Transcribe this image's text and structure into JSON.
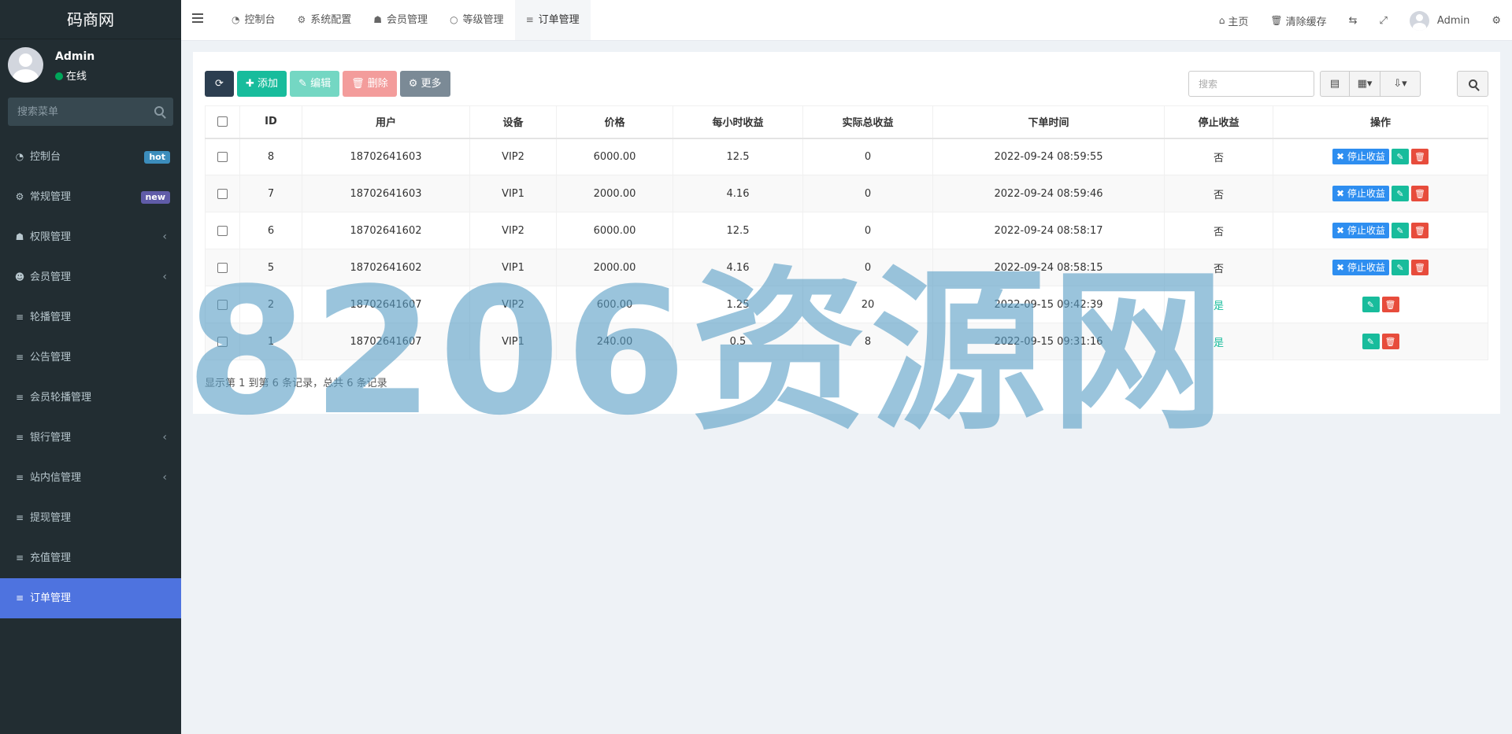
{
  "brand": "码商网",
  "user": {
    "name": "Admin",
    "status": "在线"
  },
  "sidebar": {
    "search_placeholder": "搜索菜单",
    "items": [
      {
        "icon": "dashboard-icon",
        "glyph": "◔",
        "label": "控制台",
        "badge": "hot"
      },
      {
        "icon": "cogs-icon",
        "glyph": "⚙",
        "label": "常规管理",
        "badge": "new"
      },
      {
        "icon": "users-icon",
        "glyph": "☗",
        "label": "权限管理",
        "chevron": "‹"
      },
      {
        "icon": "user-circle-icon",
        "glyph": "☻",
        "label": "会员管理",
        "chevron": "‹"
      },
      {
        "icon": "list-icon",
        "glyph": "≡",
        "label": "轮播管理"
      },
      {
        "icon": "list-icon",
        "glyph": "≡",
        "label": "公告管理"
      },
      {
        "icon": "list-icon",
        "glyph": "≡",
        "label": "会员轮播管理"
      },
      {
        "icon": "list-icon",
        "glyph": "≡",
        "label": "银行管理",
        "chevron": "‹"
      },
      {
        "icon": "list-icon",
        "glyph": "≡",
        "label": "站内信管理",
        "chevron": "‹"
      },
      {
        "icon": "list-icon",
        "glyph": "≡",
        "label": "提现管理"
      },
      {
        "icon": "list-icon",
        "glyph": "≡",
        "label": "充值管理"
      },
      {
        "icon": "list-icon",
        "glyph": "≡",
        "label": "订单管理",
        "active": true
      }
    ]
  },
  "header": {
    "tabs": [
      {
        "icon": "dashboard-icon",
        "glyph": "◔",
        "label": "控制台"
      },
      {
        "icon": "gear-icon",
        "glyph": "⚙",
        "label": "系统配置"
      },
      {
        "icon": "user-icon",
        "glyph": "☗",
        "label": "会员管理"
      },
      {
        "icon": "circle-icon",
        "glyph": "○",
        "label": "等级管理"
      },
      {
        "icon": "list-icon",
        "glyph": "≡",
        "label": "订单管理",
        "active": true
      }
    ],
    "home_label": "主页",
    "clear_cache_label": "清除缓存",
    "admin_label": "Admin"
  },
  "toolbar": {
    "add_label": "添加",
    "edit_label": "编辑",
    "delete_label": "删除",
    "more_label": "更多",
    "search_placeholder": "搜索"
  },
  "table": {
    "columns": [
      "ID",
      "用户",
      "设备",
      "价格",
      "每小时收益",
      "实际总收益",
      "下单时间",
      "停止收益",
      "操作"
    ],
    "rows": [
      {
        "id": "8",
        "user": "18702641603",
        "device": "VIP2",
        "price": "6000.00",
        "hourly": "12.5",
        "total": "0",
        "time": "2022-09-24 08:59:55",
        "stopped": "否"
      },
      {
        "id": "7",
        "user": "18702641603",
        "device": "VIP1",
        "price": "2000.00",
        "hourly": "4.16",
        "total": "0",
        "time": "2022-09-24 08:59:46",
        "stopped": "否"
      },
      {
        "id": "6",
        "user": "18702641602",
        "device": "VIP2",
        "price": "6000.00",
        "hourly": "12.5",
        "total": "0",
        "time": "2022-09-24 08:58:17",
        "stopped": "否"
      },
      {
        "id": "5",
        "user": "18702641602",
        "device": "VIP1",
        "price": "2000.00",
        "hourly": "4.16",
        "total": "0",
        "time": "2022-09-24 08:58:15",
        "stopped": "否"
      },
      {
        "id": "2",
        "user": "18702641607",
        "device": "VIP2",
        "price": "600.00",
        "hourly": "1.25",
        "total": "20",
        "time": "2022-09-15 09:42:39",
        "stopped": "是"
      },
      {
        "id": "1",
        "user": "18702641607",
        "device": "VIP1",
        "price": "240.00",
        "hourly": "0.5",
        "total": "8",
        "time": "2022-09-15 09:31:16",
        "stopped": "是"
      }
    ],
    "stop_label": "停止收益"
  },
  "pagination_info": "显示第 1 到第 6 条记录，总共 6 条记录",
  "watermark": "8206资源网",
  "colors": {
    "sidebar_bg": "#222d32",
    "active": "#4e73df",
    "success": "#18bc9c",
    "danger": "#e74c3c",
    "primary": "#2e8ef0"
  }
}
